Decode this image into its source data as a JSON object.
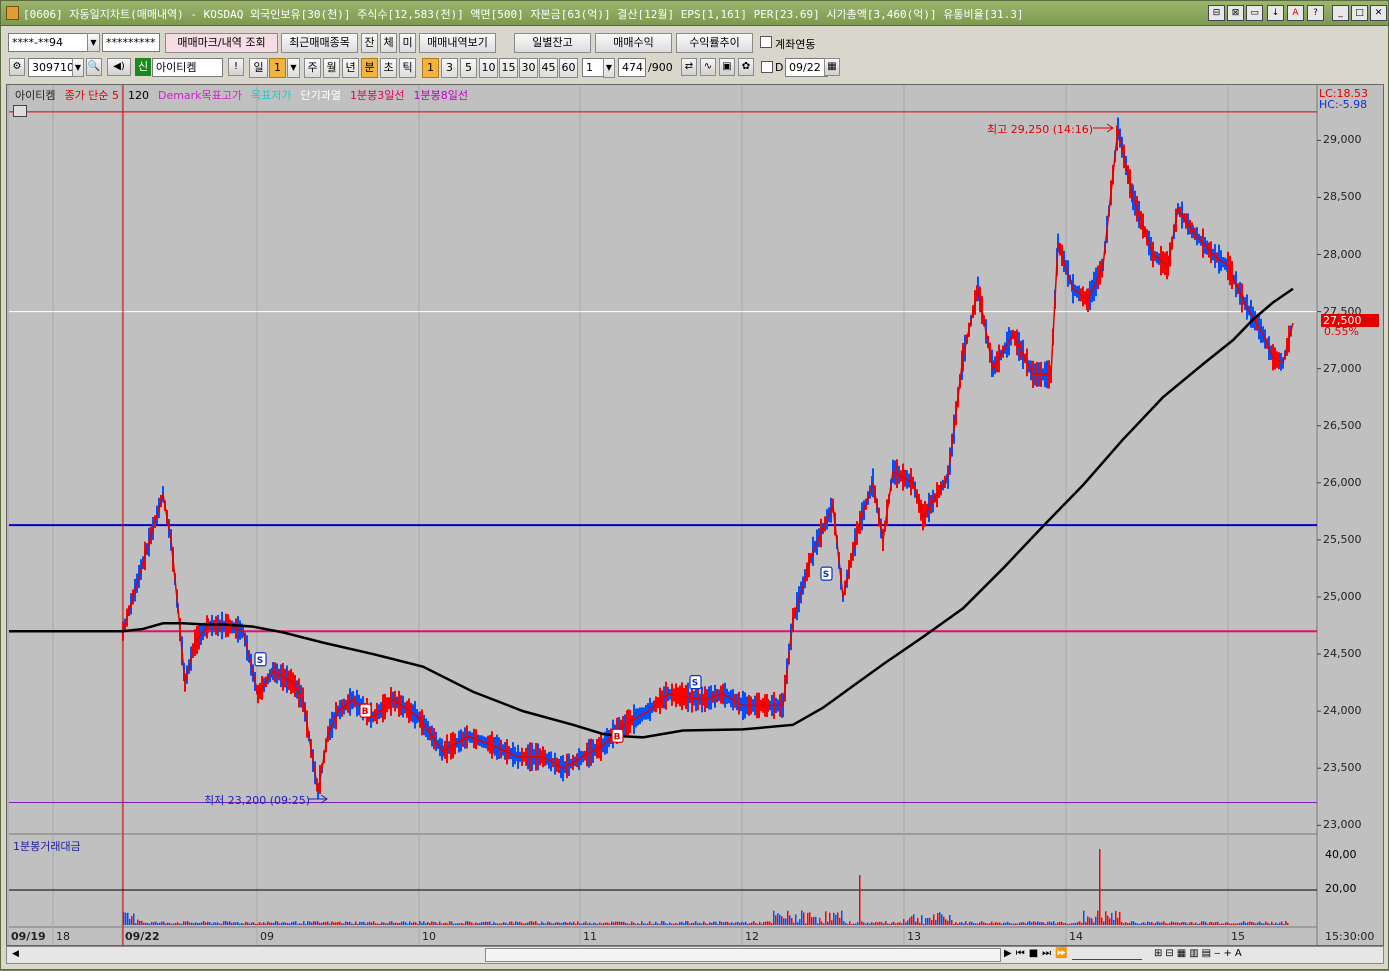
{
  "window": {
    "title": "[0606] 자동일지차트(매매내역) - KOSDAQ 외국인보유[30(천)] 주식수[12,583(천)] 액면[500] 자본금[63(억)] 결산[12월] EPS[1,161] PER[23.69] 시가총액[3,460(억)] 유통비율[31.3]",
    "buttons": [
      "⊟",
      "⊠",
      "▭",
      "↓",
      "A",
      "?",
      "_",
      "□",
      "✕"
    ]
  },
  "toolbar1": {
    "account": "****-**94",
    "password": "*********",
    "btn_mark": "매매마크/내역 조회",
    "btn_recent": "최근매매종목",
    "btn_jan": "잔",
    "btn_che": "체",
    "btn_mi": "미",
    "btn_history": "매매내역보기",
    "btn_daily": "일별잔고",
    "btn_profit": "매매수익",
    "btn_return": "수익률추이",
    "chk_link": "계좌연동"
  },
  "toolbar2": {
    "code": "309710",
    "new_badge": "신",
    "stock_name": "아이티켐",
    "excl": "!",
    "period_day": "일",
    "period_num": "1",
    "periods": [
      "주",
      "월",
      "년",
      "분",
      "초",
      "틱"
    ],
    "active_period": "분",
    "minutes": [
      "1",
      "3",
      "5",
      "10",
      "15",
      "30",
      "45",
      "60"
    ],
    "count": "1",
    "bars": "474",
    "bars_total": "/900",
    "chk_d": "D",
    "date": "09/22"
  },
  "legend": {
    "name": "아이티켐",
    "ma": "종가 단순 5",
    "ma2": "120",
    "demark_high": "Demark목표고가",
    "demark_low": "목표저가",
    "short": "단기과열",
    "l3": "1분봉3일선",
    "l8": "1분봉8일선"
  },
  "right_info": {
    "lc": "LC:18.53",
    "hc": "HC:-5.98"
  },
  "price_tag": {
    "price": "27,500",
    "pct": "0.55%"
  },
  "annotations": {
    "high": "최고 29,250 (14:16)",
    "low": "최저 23,200 (09:25)"
  },
  "y_axis": [
    "29,000",
    "28,500",
    "28,000",
    "27,500",
    "27,000",
    "26,500",
    "26,000",
    "25,500",
    "25,000",
    "24,500",
    "24,000",
    "23,500",
    "23,000"
  ],
  "vol_axis": [
    "40,00",
    "20,00"
  ],
  "vol_legend": "1분봉거래대금",
  "x_axis": [
    "09/19",
    "18",
    "09/22",
    "09",
    "10",
    "11",
    "12",
    "13",
    "14",
    "15"
  ],
  "time_label": "15:30:00",
  "markers": [
    "S",
    "B",
    "B",
    "S",
    "S"
  ],
  "colors": {
    "up": "#ff0000",
    "down": "#0050ff",
    "ma": "#000000",
    "blue_line": "#0000cc",
    "pink_line": "#e0106a",
    "purple_line": "#7a1fc0"
  },
  "chart_data": {
    "type": "line",
    "ylim": [
      22950,
      29450
    ],
    "close_path": [
      [
        0,
        24700
      ],
      [
        40,
        25900
      ],
      [
        48,
        25500
      ],
      [
        55,
        24900
      ],
      [
        62,
        24250
      ],
      [
        72,
        24600
      ],
      [
        85,
        24750
      ],
      [
        105,
        24750
      ],
      [
        120,
        24700
      ],
      [
        135,
        24150
      ],
      [
        150,
        24350
      ],
      [
        170,
        24250
      ],
      [
        180,
        24100
      ],
      [
        195,
        23300
      ],
      [
        205,
        23800
      ],
      [
        215,
        24000
      ],
      [
        230,
        24100
      ],
      [
        250,
        23950
      ],
      [
        270,
        24100
      ],
      [
        295,
        23950
      ],
      [
        320,
        23650
      ],
      [
        345,
        23780
      ],
      [
        370,
        23700
      ],
      [
        395,
        23600
      ],
      [
        420,
        23600
      ],
      [
        440,
        23500
      ],
      [
        460,
        23600
      ],
      [
        480,
        23700
      ],
      [
        490,
        23800
      ],
      [
        505,
        23900
      ],
      [
        525,
        24000
      ],
      [
        545,
        24150
      ],
      [
        580,
        24100
      ],
      [
        600,
        24150
      ],
      [
        620,
        24050
      ],
      [
        645,
        24050
      ],
      [
        660,
        24050
      ],
      [
        670,
        24800
      ],
      [
        690,
        25400
      ],
      [
        710,
        25800
      ],
      [
        720,
        25000
      ],
      [
        735,
        25600
      ],
      [
        750,
        26000
      ],
      [
        760,
        25500
      ],
      [
        770,
        26100
      ],
      [
        790,
        26000
      ],
      [
        800,
        25700
      ],
      [
        825,
        26050
      ],
      [
        840,
        27100
      ],
      [
        855,
        27700
      ],
      [
        870,
        27000
      ],
      [
        890,
        27300
      ],
      [
        910,
        26950
      ],
      [
        928,
        26950
      ],
      [
        935,
        28100
      ],
      [
        950,
        27700
      ],
      [
        965,
        27600
      ],
      [
        980,
        27900
      ],
      [
        995,
        29100
      ],
      [
        1010,
        28500
      ],
      [
        1030,
        28000
      ],
      [
        1045,
        27900
      ],
      [
        1055,
        28400
      ],
      [
        1070,
        28200
      ],
      [
        1090,
        28000
      ],
      [
        1105,
        27900
      ],
      [
        1120,
        27600
      ],
      [
        1140,
        27300
      ],
      [
        1150,
        27100
      ],
      [
        1160,
        27050
      ],
      [
        1170,
        27400
      ]
    ],
    "ma_path": [
      [
        0,
        24700
      ],
      [
        20,
        24720
      ],
      [
        40,
        24770
      ],
      [
        60,
        24770
      ],
      [
        80,
        24760
      ],
      [
        100,
        24760
      ],
      [
        130,
        24740
      ],
      [
        160,
        24690
      ],
      [
        200,
        24600
      ],
      [
        250,
        24500
      ],
      [
        300,
        24390
      ],
      [
        350,
        24170
      ],
      [
        400,
        24000
      ],
      [
        450,
        23880
      ],
      [
        480,
        23800
      ],
      [
        500,
        23780
      ],
      [
        520,
        23770
      ],
      [
        560,
        23830
      ],
      [
        620,
        23840
      ],
      [
        670,
        23880
      ],
      [
        700,
        24030
      ],
      [
        730,
        24220
      ],
      [
        760,
        24410
      ],
      [
        800,
        24650
      ],
      [
        840,
        24900
      ],
      [
        880,
        25250
      ],
      [
        920,
        25620
      ],
      [
        960,
        25980
      ],
      [
        1000,
        26380
      ],
      [
        1040,
        26750
      ],
      [
        1080,
        27040
      ],
      [
        1110,
        27250
      ],
      [
        1130,
        27430
      ],
      [
        1150,
        27580
      ],
      [
        1170,
        27700
      ]
    ],
    "hlines": {
      "blue": 25630,
      "pink": 24700,
      "red_top": 29250,
      "purple": 23200,
      "white": 27500
    }
  }
}
